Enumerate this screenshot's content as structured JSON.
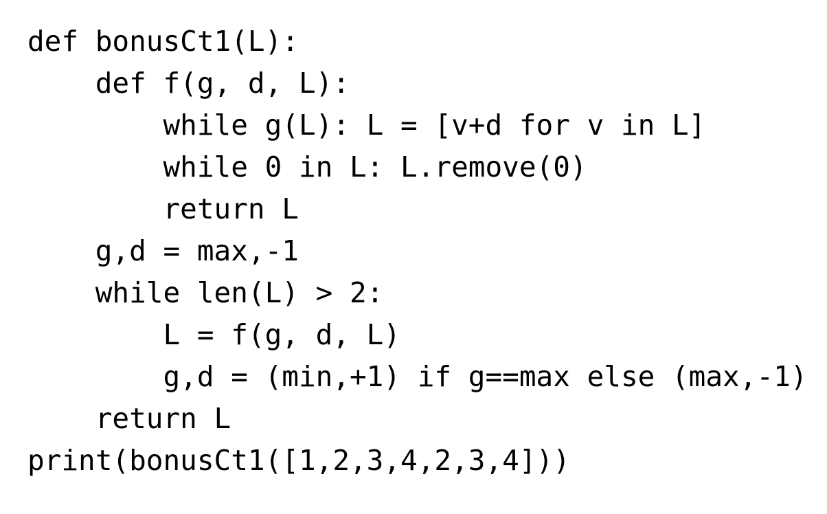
{
  "code": {
    "lines": [
      "def bonusCt1(L):",
      "    def f(g, d, L):",
      "        while g(L): L = [v+d for v in L]",
      "        while 0 in L: L.remove(0)",
      "        return L",
      "    g,d = max,-1",
      "    while len(L) > 2:",
      "        L = f(g, d, L)",
      "        g,d = (min,+1) if g==max else (max,-1)",
      "    return L",
      "print(bonusCt1([1,2,3,4,2,3,4]))"
    ]
  }
}
